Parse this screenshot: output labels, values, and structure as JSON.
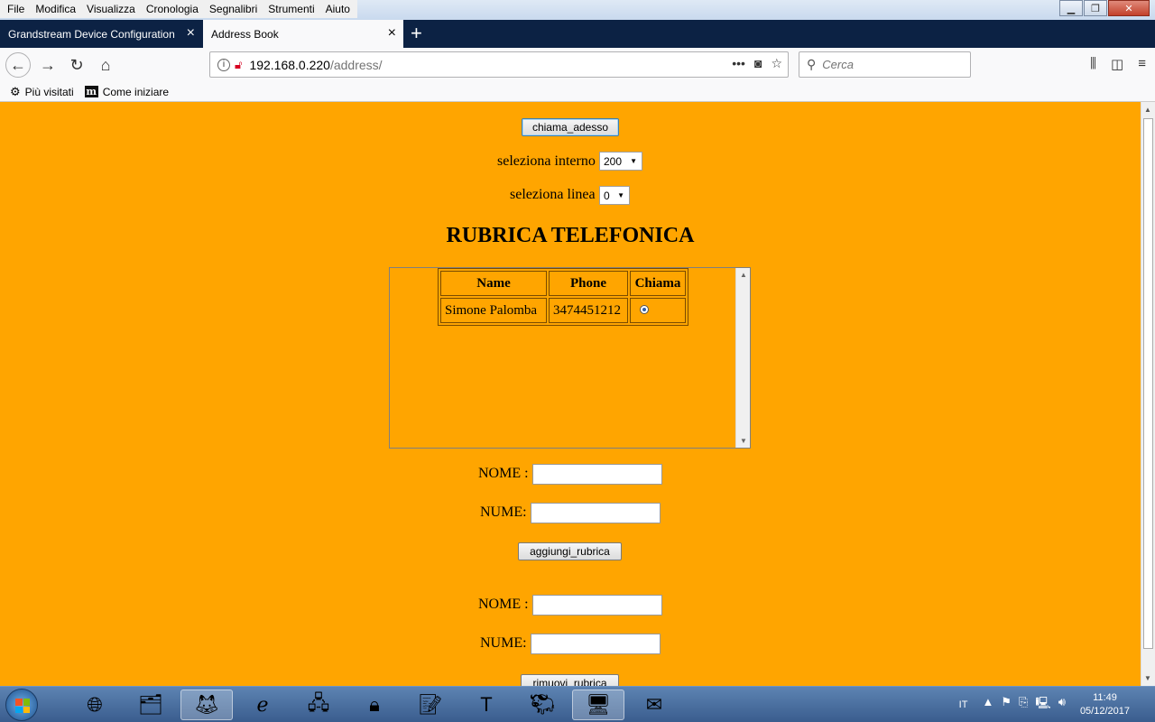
{
  "menubar": {
    "items": [
      "File",
      "Modifica",
      "Visualizza",
      "Cronologia",
      "Segnalibri",
      "Strumenti",
      "Aiuto"
    ]
  },
  "tabs": [
    {
      "label": "Grandstream Device Configuration",
      "active": false
    },
    {
      "label": "Address Book",
      "active": true
    }
  ],
  "navbar": {
    "url_host": "192.168.0.220",
    "url_path": "/address/",
    "search_placeholder": "Cerca"
  },
  "bookmarks": [
    {
      "label": "Più visitati",
      "icon": "gear-icon"
    },
    {
      "label": "Come iniziare",
      "icon": "m-logo-icon"
    }
  ],
  "page": {
    "call_button": "chiama_adesso",
    "extension_label": "seleziona interno",
    "extension_value": "200",
    "line_label": "seleziona linea",
    "line_value": "0",
    "title": "RUBRICA TELEFONICA",
    "table": {
      "headers": [
        "Name",
        "Phone",
        "Chiama"
      ],
      "rows": [
        {
          "name": "Simone Palomba",
          "phone": "3474451212",
          "selected": true
        }
      ]
    },
    "add_form": {
      "nome_label": "NOME :",
      "nume_label": "NUME:",
      "button": "aggiungi_rubrica"
    },
    "remove_form": {
      "nome_label": "NOME :",
      "nume_label": "NUME:",
      "button": "rimuovi_rubrica"
    },
    "background_color": "#ffa500"
  },
  "taskbar": {
    "apps": [
      "chrome-icon",
      "file-explorer-icon",
      "firefox-icon",
      "internet-explorer-icon",
      "network-icon",
      "lock-folder-icon",
      "notepad-icon",
      "tex-editor-icon",
      "gnu-icon",
      "remote-desktop-icon",
      "thunderbird-icon"
    ],
    "lang": "IT",
    "time": "11:49",
    "date": "05/12/2017"
  }
}
